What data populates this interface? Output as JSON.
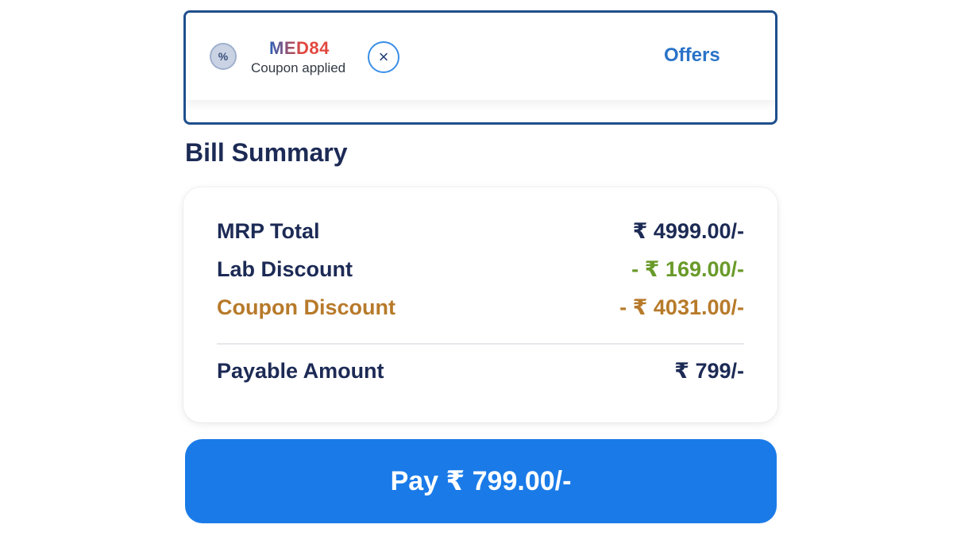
{
  "coupon": {
    "icon": "percent-badge-icon",
    "icon_glyph": "%",
    "code": "MED84",
    "status": "Coupon applied",
    "remove_glyph": "×",
    "offers_label": "Offers"
  },
  "bill_summary": {
    "heading": "Bill Summary",
    "rows": [
      {
        "label": "MRP Total",
        "amount": "₹ 4999.00/-"
      },
      {
        "label": "Lab Discount",
        "amount": "- ₹ 169.00/-"
      },
      {
        "label": "Coupon Discount",
        "amount": "- ₹ 4031.00/-"
      }
    ],
    "total": {
      "label": "Payable Amount",
      "amount": "₹ 799/-"
    }
  },
  "pay_button": {
    "label": "Pay ₹ 799.00/-"
  },
  "colors": {
    "primary": "#1a7be8",
    "heading": "#1c2a55",
    "discount_green": "#6a9a2a",
    "coupon_brown": "#b77a2a",
    "border_navy": "#1f4f8c"
  }
}
